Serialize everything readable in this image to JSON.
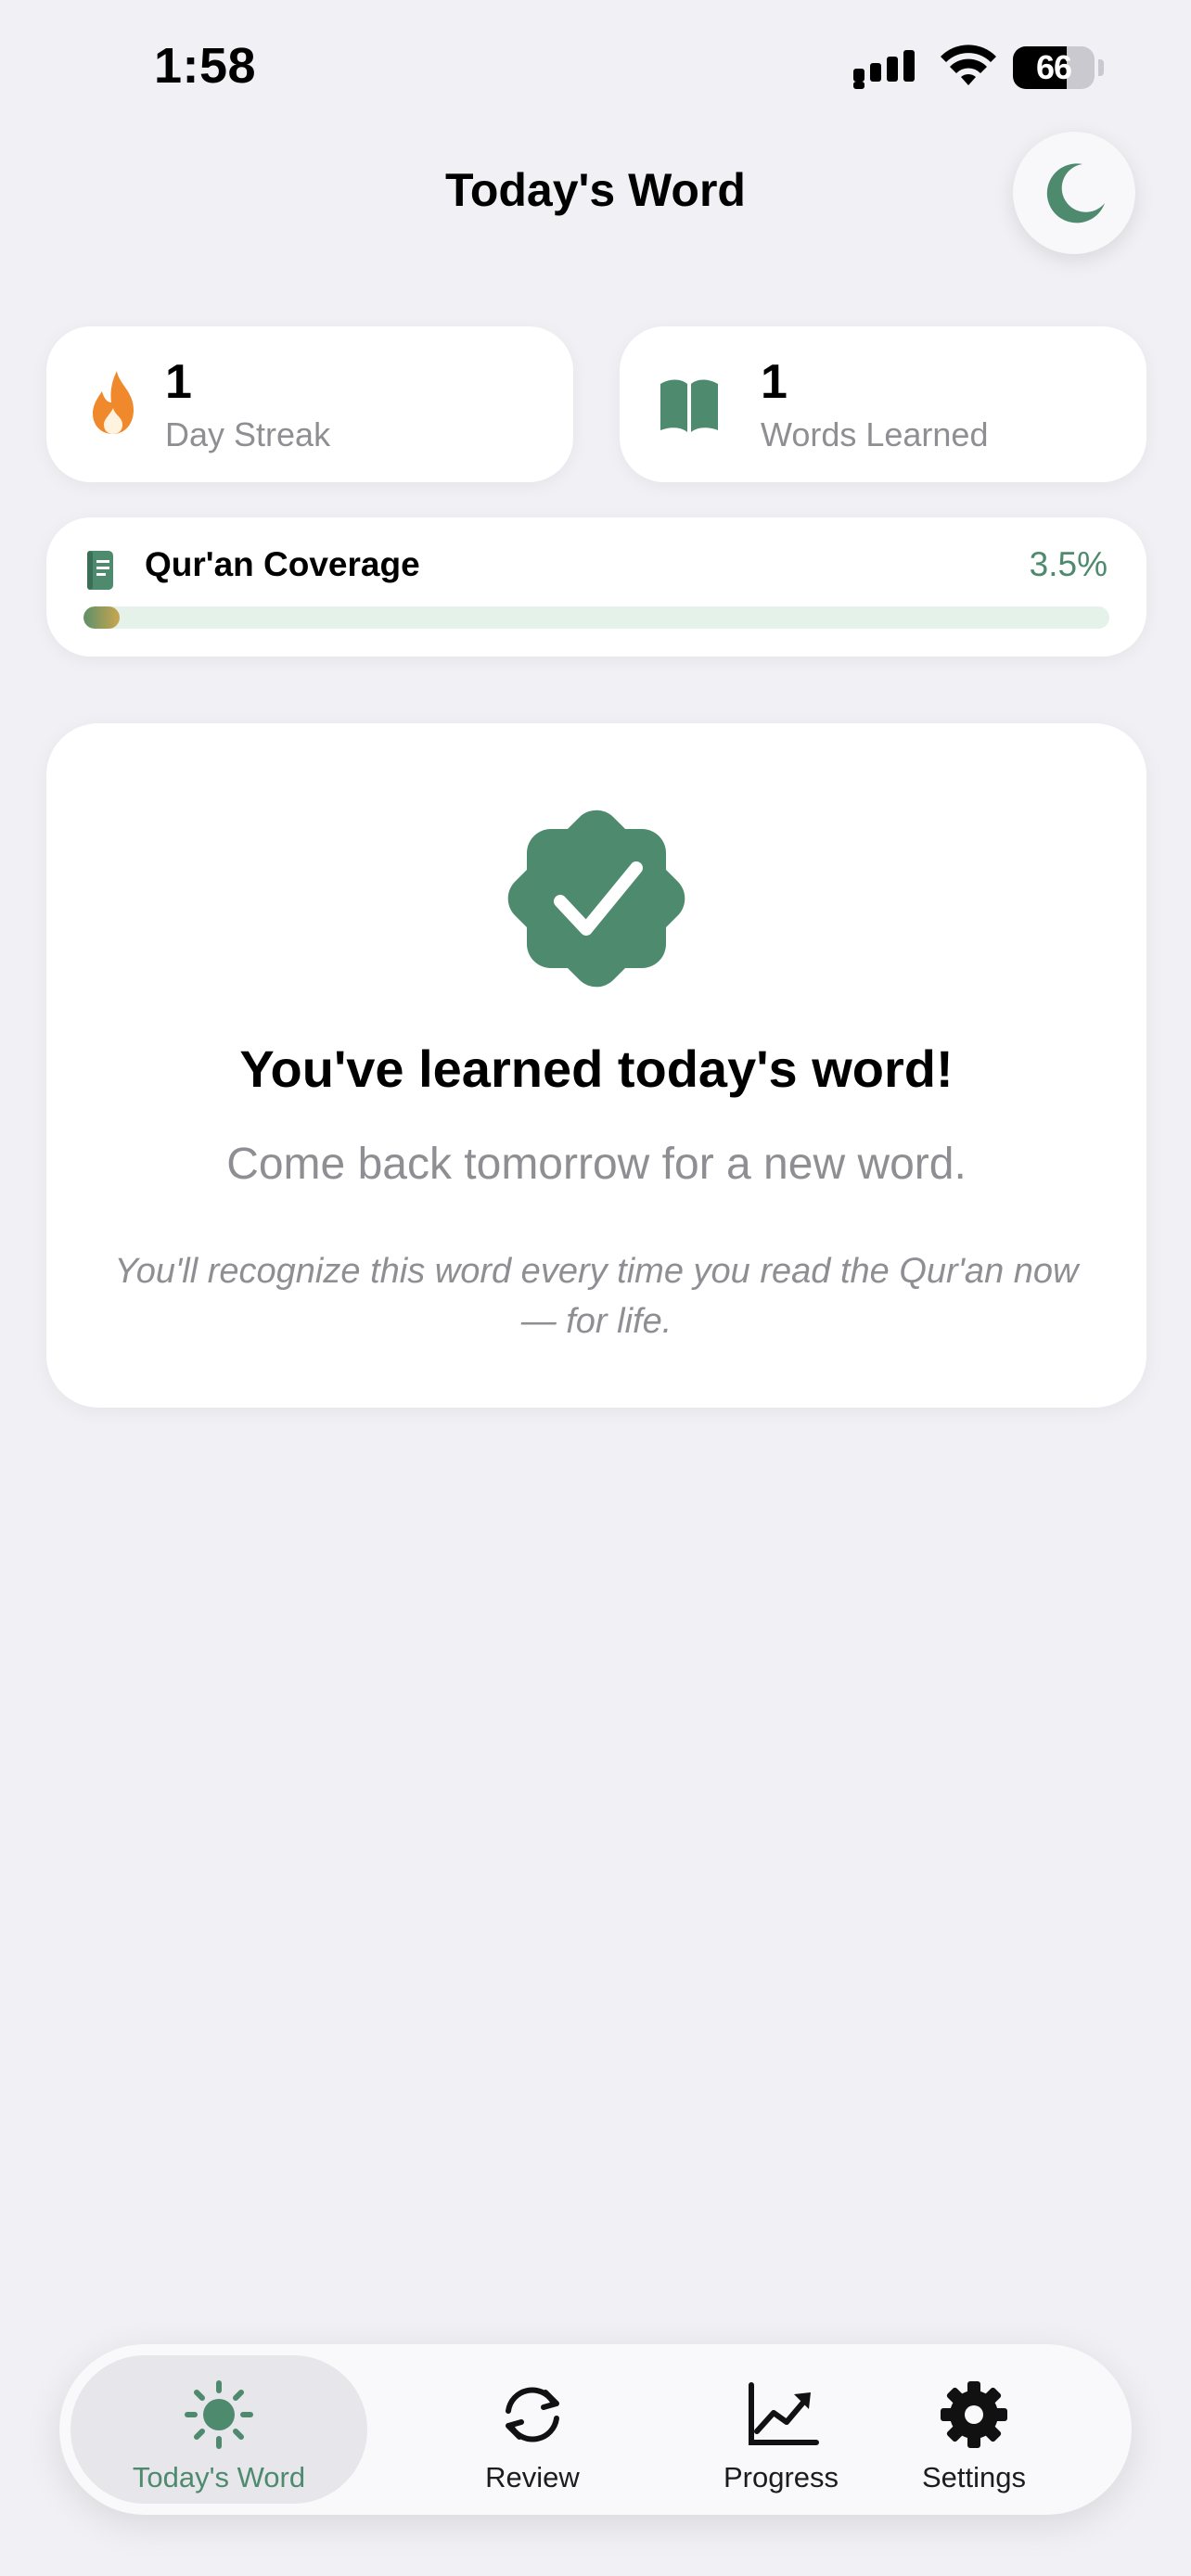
{
  "status_bar": {
    "time": "1:58",
    "battery_level": "66",
    "icons": [
      "cellular-signal-icon",
      "wifi-icon",
      "battery-icon"
    ]
  },
  "header": {
    "title": "Today's Word",
    "theme_toggle_icon": "moon-icon"
  },
  "stats": {
    "streak": {
      "value": "1",
      "label": "Day Streak",
      "icon": "flame-icon",
      "color": "#f0892c"
    },
    "words": {
      "value": "1",
      "label": "Words Learned",
      "icon": "open-book-icon",
      "color": "#4e8a6e"
    }
  },
  "coverage": {
    "title": "Qur'an Coverage",
    "percent_text": "3.5%",
    "fraction": 0.035,
    "icon": "book-icon"
  },
  "completion": {
    "icon": "verified-badge-icon",
    "title": "You've learned today's word!",
    "subtitle": "Come back tomorrow for a new word.",
    "note": "You'll recognize this word every time you read the Qur'an now — for life."
  },
  "tabs": [
    {
      "label": "Today's Word",
      "icon": "sun-icon",
      "active": true
    },
    {
      "label": "Review",
      "icon": "refresh-icon",
      "active": false
    },
    {
      "label": "Progress",
      "icon": "chart-icon",
      "active": false
    },
    {
      "label": "Settings",
      "icon": "gear-icon",
      "active": false
    }
  ],
  "colors": {
    "accent": "#4e8a6e",
    "background": "#f0f0f5",
    "streak": "#f0892c"
  }
}
